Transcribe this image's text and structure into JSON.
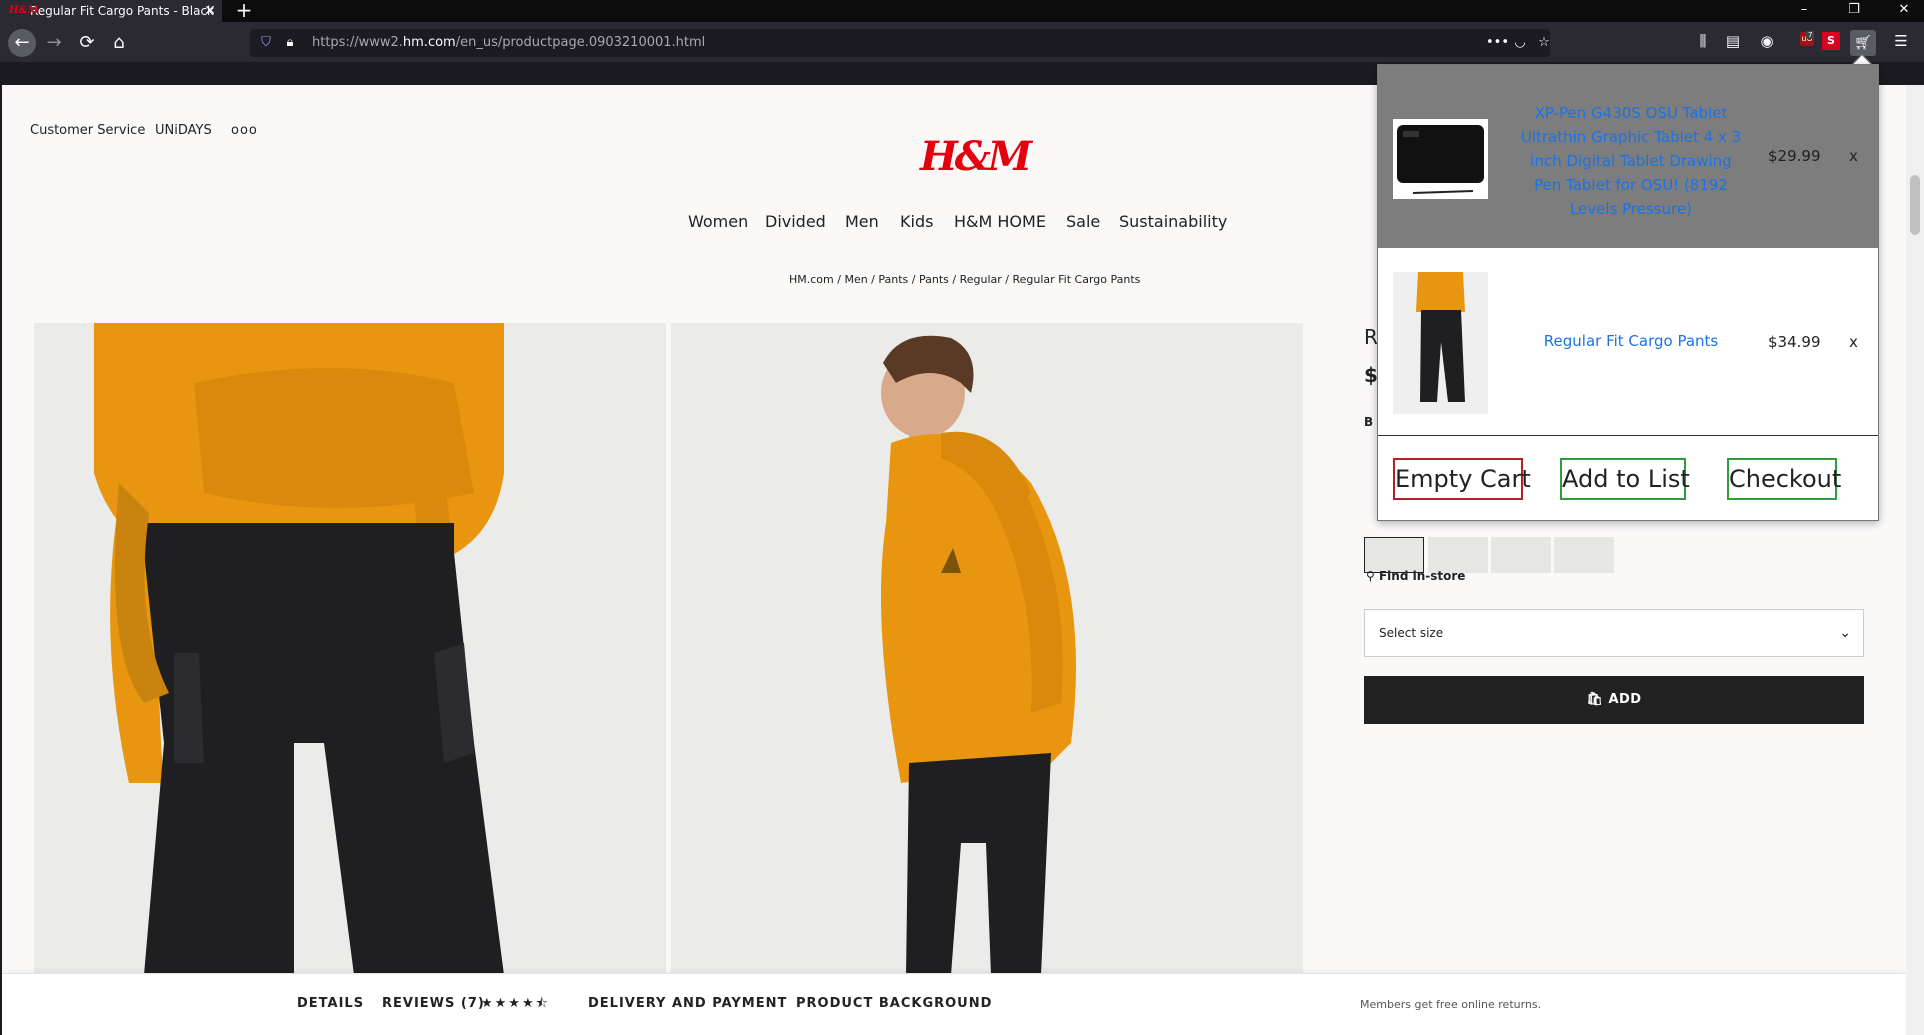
{
  "browser": {
    "tab_title": "Regular Fit Cargo Pants - Black",
    "favicon_text": "H&M",
    "url_prefix": "https://www2.",
    "url_domain": "hm.com",
    "url_path": "/en_us/productpage.0903210001.html",
    "ublock_count": "7",
    "ext_s_label": "S"
  },
  "site": {
    "utility": {
      "customer_service": "Customer Service",
      "unidays": "UNiDAYS",
      "more": "ooo"
    },
    "logo": "H&M",
    "nav": [
      "Women",
      "Divided",
      "Men",
      "Kids",
      "H&M HOME",
      "Sale",
      "Sustainability"
    ],
    "breadcrumb": "HM.com / Men / Pants / Pants / Regular / Regular Fit Cargo Pants"
  },
  "product": {
    "title_fragment": "R",
    "price_fragment": "$",
    "color_fragment": "B",
    "find_in_store": "Find in-store",
    "size_placeholder": "Select size",
    "add_label": "ADD"
  },
  "bottom_bar": {
    "details": "DETAILS",
    "reviews": "REVIEWS (7)",
    "rating": 4.5,
    "rating_stars": "★★★★⯪",
    "delivery": "DELIVERY AND PAYMENT",
    "background": "PRODUCT BACKGROUND",
    "members_note": "Members get free online returns."
  },
  "cart_popup": {
    "items": [
      {
        "name": "XP-Pen G430S OSU Tablet Ultrathin Graphic Tablet 4 x 3 inch Digital Tablet Drawing Pen Tablet for OSU! (8192 Levels Pressure)",
        "price": "$29.99",
        "remove": "x",
        "highlighted": true
      },
      {
        "name": "Regular Fit Cargo Pants",
        "price": "$34.99",
        "remove": "x",
        "highlighted": false
      }
    ],
    "buttons": {
      "empty": "Empty Cart",
      "add_list": "Add to List",
      "checkout": "Checkout"
    },
    "colors": {
      "empty_border": "#b22222",
      "list_border": "#2e9e3a",
      "checkout_border": "#2e9e3a",
      "link": "#1a73e8",
      "highlight_row": "#7d7d7d"
    }
  }
}
